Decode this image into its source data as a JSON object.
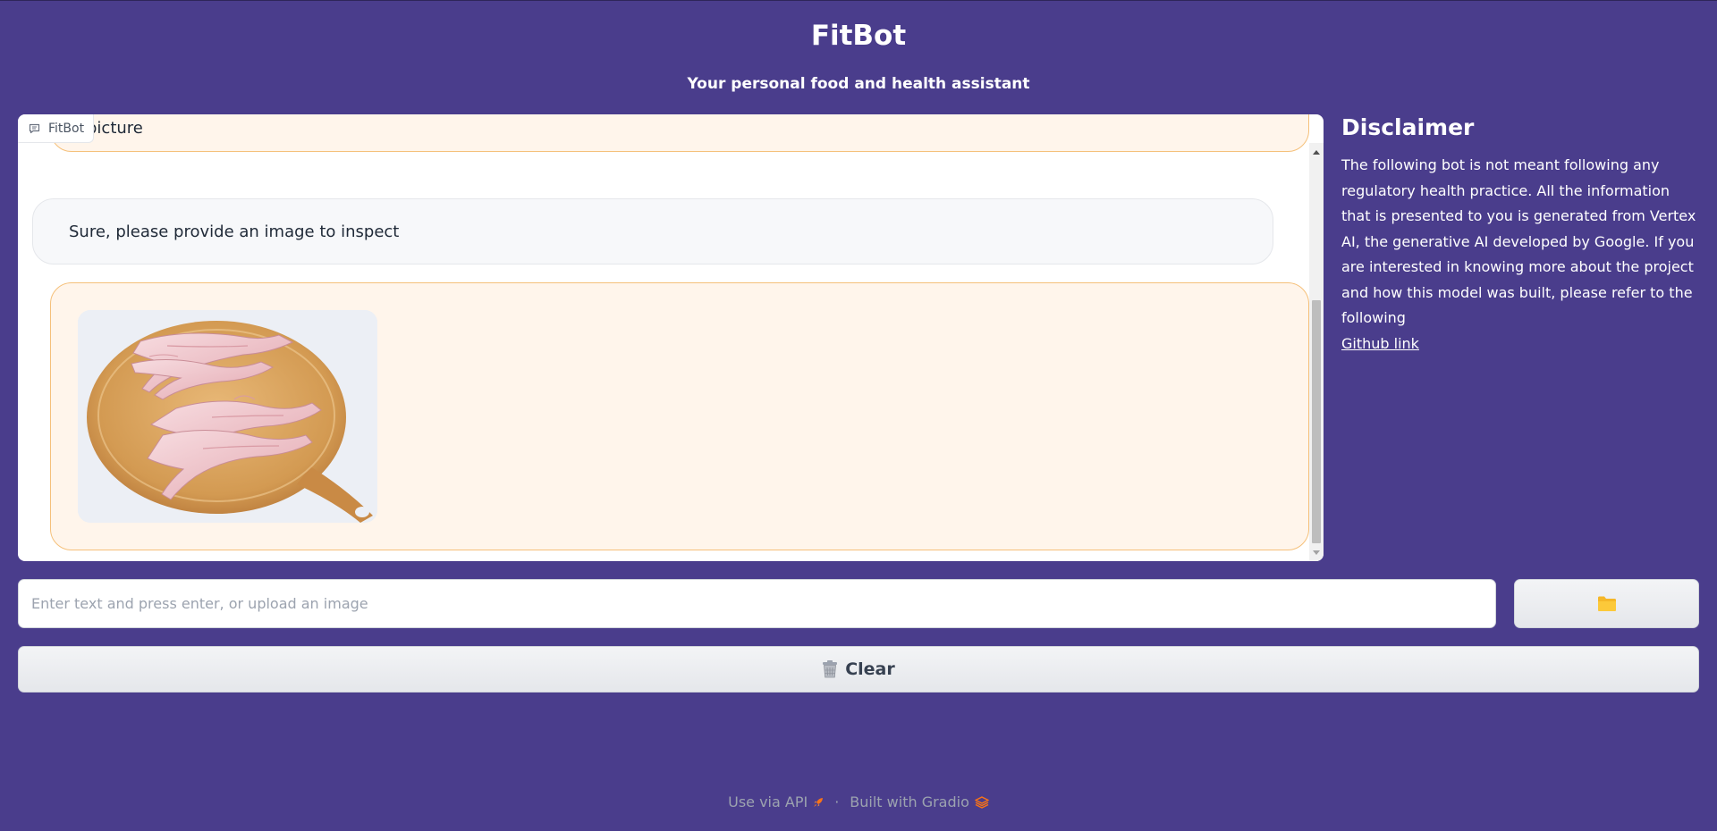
{
  "header": {
    "title": "FitBot",
    "subtitle": "Your personal food and health assistant"
  },
  "chatbot": {
    "label": "FitBot",
    "messages": [
      {
        "role": "user",
        "text": "picture"
      },
      {
        "role": "bot",
        "text": "Sure, please provide an image to inspect"
      },
      {
        "role": "user",
        "image": "chicken-wings-on-cutting-board"
      }
    ]
  },
  "disclaimer": {
    "title": "Disclaimer",
    "body": "The following bot is not meant following any regulatory health practice. All the information that is presented to you is generated from Vertex AI, the generative AI developed by Google. If you are interested in knowing more about the project and how this model was built, please refer to the following",
    "link_text": "Github link"
  },
  "input": {
    "placeholder": "Enter text and press enter, or upload an image",
    "value": ""
  },
  "upload_button": {
    "icon": "folder-icon"
  },
  "clear_button": {
    "label": "Clear",
    "icon": "trash-icon"
  },
  "footer": {
    "api_label": "Use via API",
    "separator": "·",
    "gradio_label": "Built with Gradio"
  },
  "colors": {
    "background": "#4a3d8c",
    "user_bubble": "#fff5eb",
    "user_border": "#f5c07a",
    "bot_bubble": "#f7f8fa",
    "accent": "#f97316"
  }
}
